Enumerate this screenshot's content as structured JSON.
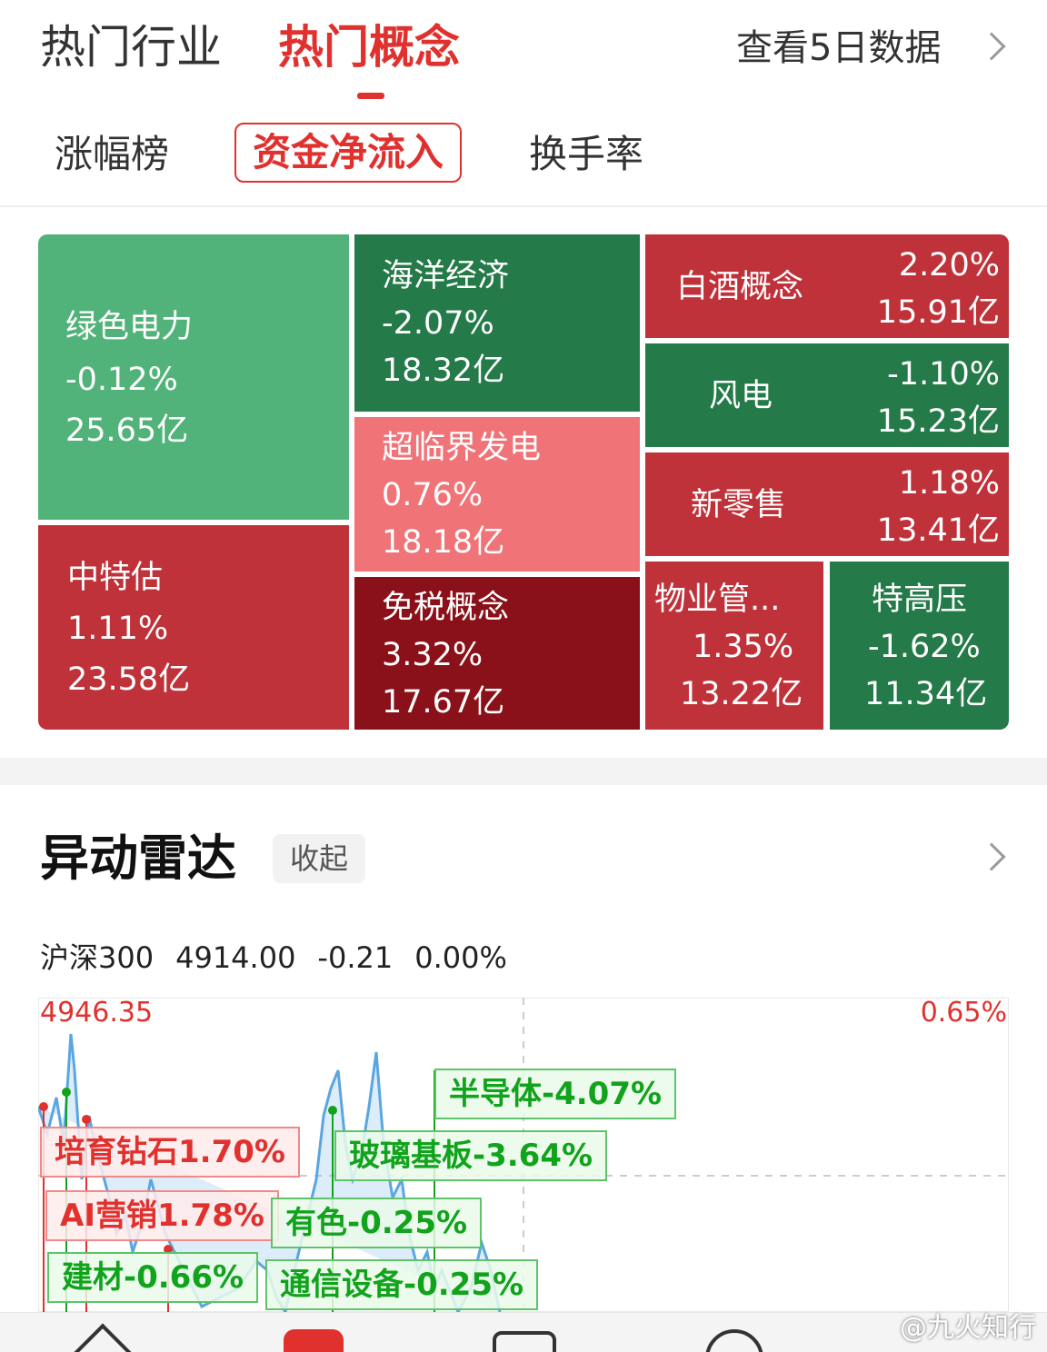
{
  "top_tabs": [
    {
      "label": "热门行业",
      "active": false
    },
    {
      "label": "热门概念",
      "active": true
    }
  ],
  "view_5day": "查看5日数据",
  "sub_tabs": [
    {
      "label": "涨幅榜",
      "active": false
    },
    {
      "label": "资金净流入",
      "active": true
    },
    {
      "label": "换手率",
      "active": false
    }
  ],
  "colors": {
    "accent": "#e0312e",
    "tile_light_green": "#52b37a",
    "tile_green": "#247a48",
    "tile_red": "#c0323a",
    "tile_pink": "#f07378",
    "tile_dark_red": "#8a1119",
    "up_tag": "#e0312e",
    "down_tag": "#11a31c"
  },
  "treemap": [
    {
      "name": "绿色电力",
      "change": "-0.12%",
      "flow": "25.65亿"
    },
    {
      "name": "中特估",
      "change": "1.11%",
      "flow": "23.58亿"
    },
    {
      "name": "海洋经济",
      "change": "-2.07%",
      "flow": "18.32亿"
    },
    {
      "name": "超临界发电",
      "change": "0.76%",
      "flow": "18.18亿"
    },
    {
      "name": "免税概念",
      "change": "3.32%",
      "flow": "17.67亿"
    },
    {
      "name": "白酒概念",
      "change": "2.20%",
      "flow": "15.91亿"
    },
    {
      "name": "风电",
      "change": "-1.10%",
      "flow": "15.23亿"
    },
    {
      "name": "新零售",
      "change": "1.18%",
      "flow": "13.41亿"
    },
    {
      "name": "物业管...",
      "change": "1.35%",
      "flow": "13.22亿"
    },
    {
      "name": "特高压",
      "change": "-1.62%",
      "flow": "11.34亿"
    }
  ],
  "radar": {
    "title": "异动雷达",
    "collapse_label": "收起",
    "index": {
      "name": "沪深300",
      "price": "4914.00",
      "change": "-0.21",
      "pct": "0.00%"
    },
    "axis_high": "4946.35",
    "axis_high_pct": "0.65%",
    "tags": [
      {
        "label": "培育钻石1.70%",
        "dir": "up"
      },
      {
        "label": "AI营销1.78%",
        "dir": "up"
      },
      {
        "label": "建材-0.66%",
        "dir": "down"
      },
      {
        "label": "有色-0.25%",
        "dir": "down"
      },
      {
        "label": "通信设备-0.25%",
        "dir": "down"
      },
      {
        "label": "玻璃基板-3.64%",
        "dir": "down"
      },
      {
        "label": "半导体-4.07%",
        "dir": "down"
      }
    ]
  },
  "watermark": "@九火知行"
}
